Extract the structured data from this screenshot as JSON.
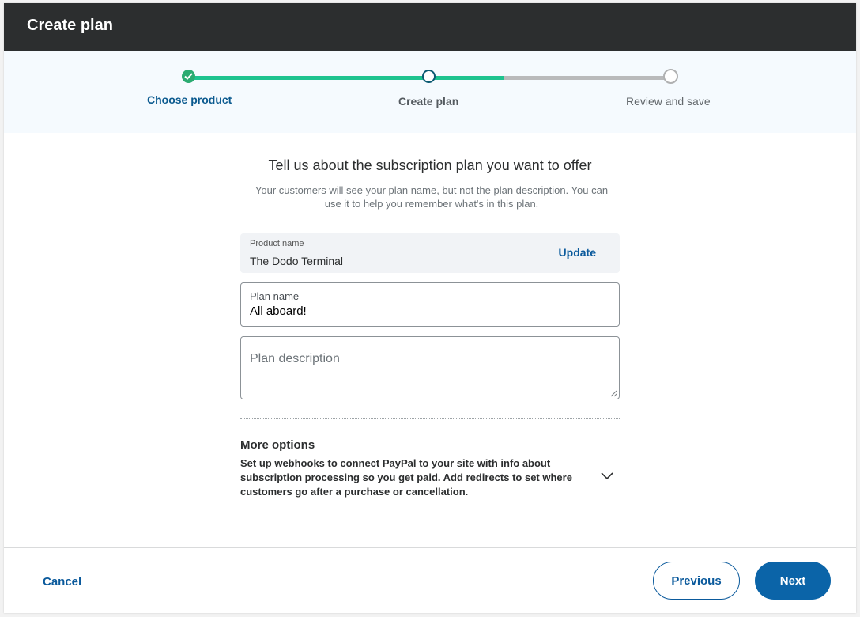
{
  "header": {
    "title": "Create plan"
  },
  "stepper": {
    "steps": [
      {
        "label": "Choose product",
        "state": "done"
      },
      {
        "label": "Create plan",
        "state": "current"
      },
      {
        "label": "Review and save",
        "state": "todo"
      }
    ],
    "colors": {
      "done": "#1ec38f",
      "todo": "#b9babb",
      "current_border": "#0b5a72"
    }
  },
  "intro": {
    "title": "Tell us about the subscription plan you want to offer",
    "subtitle": "Your customers will see your plan name, but not the plan description. You can use it to help you remember what's in this plan."
  },
  "product": {
    "label": "Product name",
    "value": "The Dodo Terminal",
    "update_label": "Update"
  },
  "plan_name": {
    "label": "Plan name",
    "value": "All aboard!"
  },
  "plan_description": {
    "placeholder": "Plan description",
    "value": ""
  },
  "more_options": {
    "title": "More options",
    "description": "Set up webhooks to connect PayPal to your site with info about subscription processing so you get paid. Add redirects to set where customers go after a purchase or cancellation.",
    "icon": "chevron-down-icon"
  },
  "footer": {
    "cancel_label": "Cancel",
    "previous_label": "Previous",
    "next_label": "Next"
  },
  "colors": {
    "brand_blue": "#0b64a8",
    "header_bg": "#2c2e2f"
  }
}
